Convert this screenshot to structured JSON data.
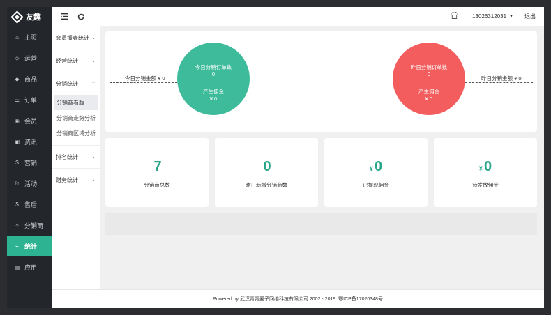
{
  "brand": {
    "name": "友趣"
  },
  "nav": [
    {
      "label": "主页",
      "icon": "home-icon",
      "glyph": "⌂"
    },
    {
      "label": "运营",
      "icon": "shield-icon",
      "glyph": "◇"
    },
    {
      "label": "商品",
      "icon": "tag-icon",
      "glyph": "◆"
    },
    {
      "label": "订单",
      "icon": "list-icon",
      "glyph": "☰"
    },
    {
      "label": "会员",
      "icon": "users-icon",
      "glyph": "◉"
    },
    {
      "label": "资讯",
      "icon": "news-icon",
      "glyph": "▣"
    },
    {
      "label": "营销",
      "icon": "dollar-icon",
      "glyph": "$"
    },
    {
      "label": "活动",
      "icon": "flag-icon",
      "glyph": "⚐"
    },
    {
      "label": "售后",
      "icon": "coin-icon",
      "glyph": "$"
    },
    {
      "label": "分销商",
      "icon": "user-icon",
      "glyph": "○"
    },
    {
      "label": "统计",
      "icon": "pulse-icon",
      "glyph": "⌁"
    },
    {
      "label": "应用",
      "icon": "apps-icon",
      "glyph": "▤"
    }
  ],
  "topbar": {
    "user": "13026312031",
    "logout": "退出"
  },
  "submenu": {
    "groups": [
      {
        "title": "会员报表统计",
        "chev": "⌄"
      },
      {
        "title": "经营统计",
        "chev": "⌄"
      },
      {
        "title": "分销统计",
        "chev": "⌃",
        "items": [
          "分销商看版",
          "分销商走势分析",
          "分销商区域分析"
        ]
      },
      {
        "title": "排名统计",
        "chev": "⌄"
      },
      {
        "title": "财务统计",
        "chev": "⌄"
      }
    ]
  },
  "overview": {
    "today_amount_label": "今日分销金额 ¥ 0",
    "yesterday_amount_label": "昨日分销金额 ¥ 0",
    "today": {
      "orders_label": "今日分销订单数",
      "orders_value": "0",
      "commission_label": "产生佣金",
      "commission_value": "¥ 0"
    },
    "yesterday": {
      "orders_label": "昨日分销订单数",
      "orders_value": "0",
      "commission_label": "产生佣金",
      "commission_value": "¥ 0"
    }
  },
  "stats": [
    {
      "value": "7",
      "currency": "",
      "label": "分销商总数"
    },
    {
      "value": "0",
      "currency": "",
      "label": "昨日新增分销商数"
    },
    {
      "value": "0",
      "currency": "¥",
      "label": "已提现佣金"
    },
    {
      "value": "0",
      "currency": "¥",
      "label": "待发放佣金"
    }
  ],
  "footer": "Powered by 武汉青青麦子网络科技有限公司 2002 - 2019. 鄂ICP备17020348号",
  "colors": {
    "accent": "#2db391",
    "green_circle": "#3dbb9b",
    "red_circle": "#f35d5d",
    "sidebar": "#23262b"
  }
}
